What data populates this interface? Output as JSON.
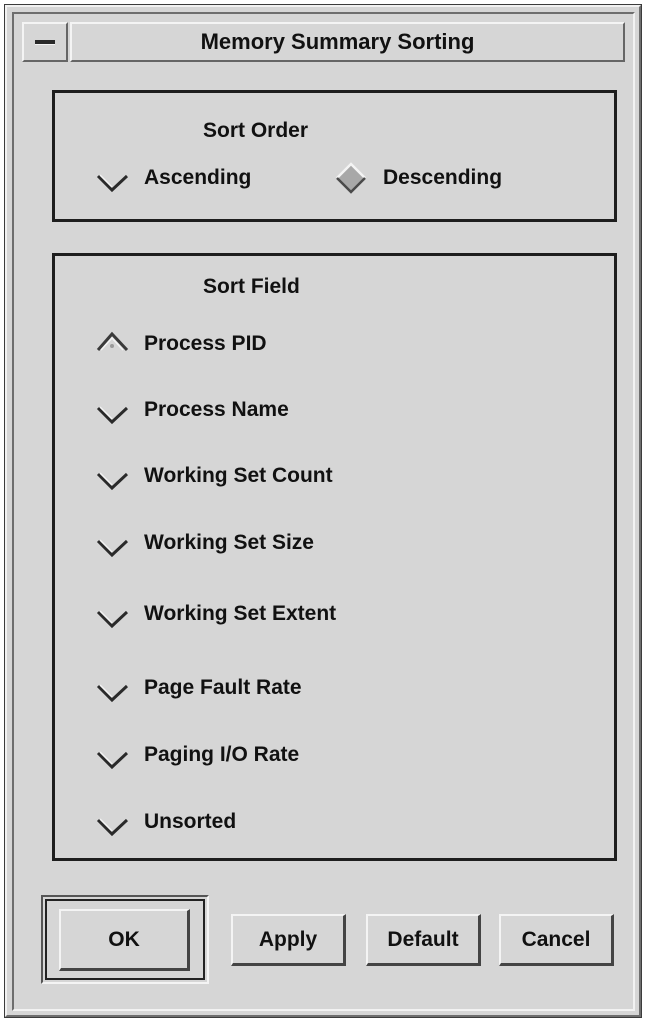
{
  "window": {
    "title": "Memory Summary Sorting",
    "menu_icon": "window-menu-bar-icon"
  },
  "sort_order": {
    "title": "Sort Order",
    "options": [
      {
        "label": "Ascending",
        "selected": false
      },
      {
        "label": "Descending",
        "selected": true
      }
    ]
  },
  "sort_field": {
    "title": "Sort Field",
    "options": [
      {
        "label": "Process PID",
        "selected": true
      },
      {
        "label": "Process Name",
        "selected": false
      },
      {
        "label": "Working Set Count",
        "selected": false
      },
      {
        "label": "Working Set Size",
        "selected": false
      },
      {
        "label": "Working Set Extent",
        "selected": false
      },
      {
        "label": "Page Fault Rate",
        "selected": false
      },
      {
        "label": "Paging I/O Rate",
        "selected": false
      },
      {
        "label": "Unsorted",
        "selected": false
      }
    ]
  },
  "buttons": {
    "ok": "OK",
    "apply": "Apply",
    "default": "Default",
    "cancel": "Cancel"
  },
  "colors": {
    "background": "#d6d6d6",
    "frame_dark": "#1e1e1e",
    "selected_fill": "#a8a8a8"
  }
}
